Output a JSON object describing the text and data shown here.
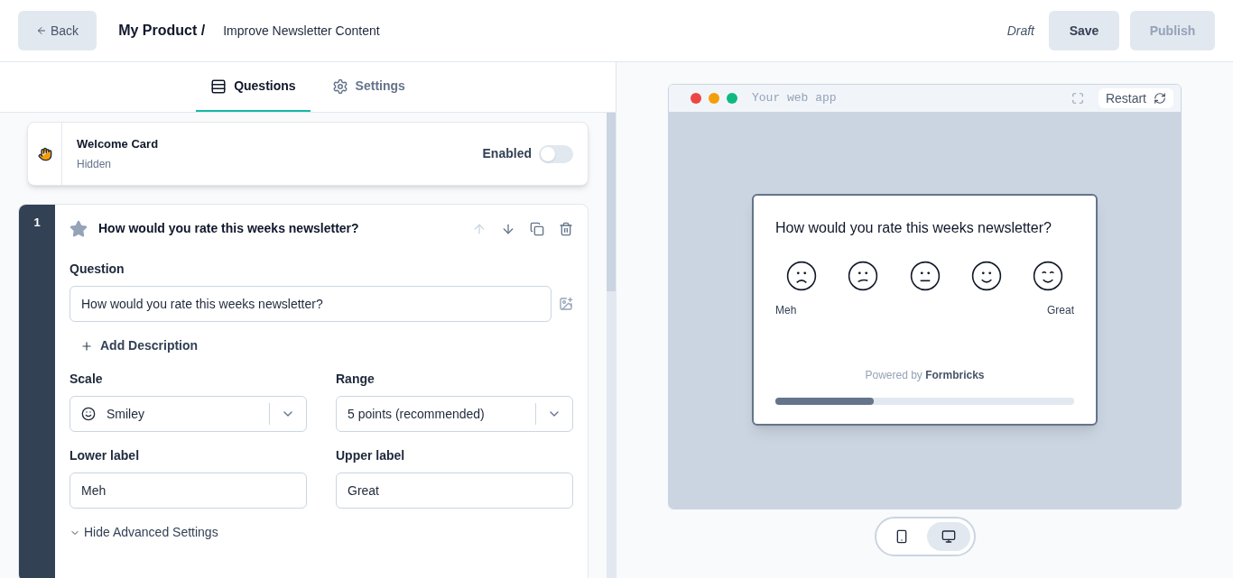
{
  "header": {
    "back": "Back",
    "product": "My Product /",
    "survey": "Improve Newsletter Content",
    "status": "Draft",
    "save": "Save",
    "publish": "Publish",
    "publish_disabled": true
  },
  "tabs": [
    {
      "label": "Questions",
      "kind": "questions",
      "selected": true
    },
    {
      "label": "Settings",
      "kind": "settings",
      "selected": false
    }
  ],
  "welcome_card": {
    "title": "Welcome Card",
    "subtitle": "Hidden",
    "toggle_label": "Enabled",
    "on": false
  },
  "question_card": {
    "number": "1",
    "title": "How would you rate this weeks newsletter?",
    "question_label": "Question",
    "question_value": "How would you rate this weeks newsletter?",
    "add_description": "Add Description",
    "scale_label": "Scale",
    "scale_value": "Smiley",
    "range_label": "Range",
    "range_value": "5 points (recommended)",
    "lower_label": "Lower label",
    "lower_value": "Meh",
    "upper_label": "Upper label",
    "upper_value": "Great",
    "advanced": "Hide Advanced Settings"
  },
  "preview": {
    "title": "Your web app",
    "restart": "Restart",
    "question": "How would you rate this weeks newsletter?",
    "faces": [
      {
        "kind": "frown"
      },
      {
        "kind": "confused"
      },
      {
        "kind": "neutral"
      },
      {
        "kind": "smile"
      },
      {
        "kind": "happy"
      }
    ],
    "lower": "Meh",
    "upper": "Great",
    "powered": "Powered by **Formbricks**",
    "progress": {
      "level": 0.33
    }
  },
  "devices": [
    {
      "kind": "mobile",
      "selected": false
    },
    {
      "kind": "desktop",
      "selected": true
    }
  ]
}
